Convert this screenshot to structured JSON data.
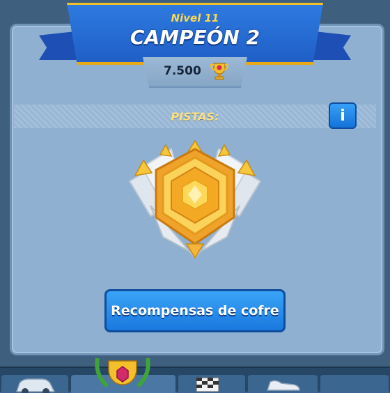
{
  "header": {
    "level_label": "Nivel 11",
    "league_title": "CAMPEÓN 2",
    "trophies": "7.500"
  },
  "tracks": {
    "label": "PISTAS:",
    "info_button_label": "i"
  },
  "badge": {
    "icon": "champion-league-badge-icon"
  },
  "actions": {
    "chest_rewards_label": "Recompensas de cofre"
  },
  "bottom_nav": {
    "items": [
      {
        "icon": "car-icon"
      },
      {
        "icon": "league-trophy-icon",
        "selected": true
      },
      {
        "icon": "checkered-flag-icon"
      },
      {
        "icon": "sneaker-icon"
      }
    ]
  },
  "colors": {
    "background": "#3e5f7d",
    "panel": "#8fb0d0",
    "ribbon": "#1f5fc6",
    "gold": "#f1c12c",
    "button_blue": "#1a78de"
  }
}
